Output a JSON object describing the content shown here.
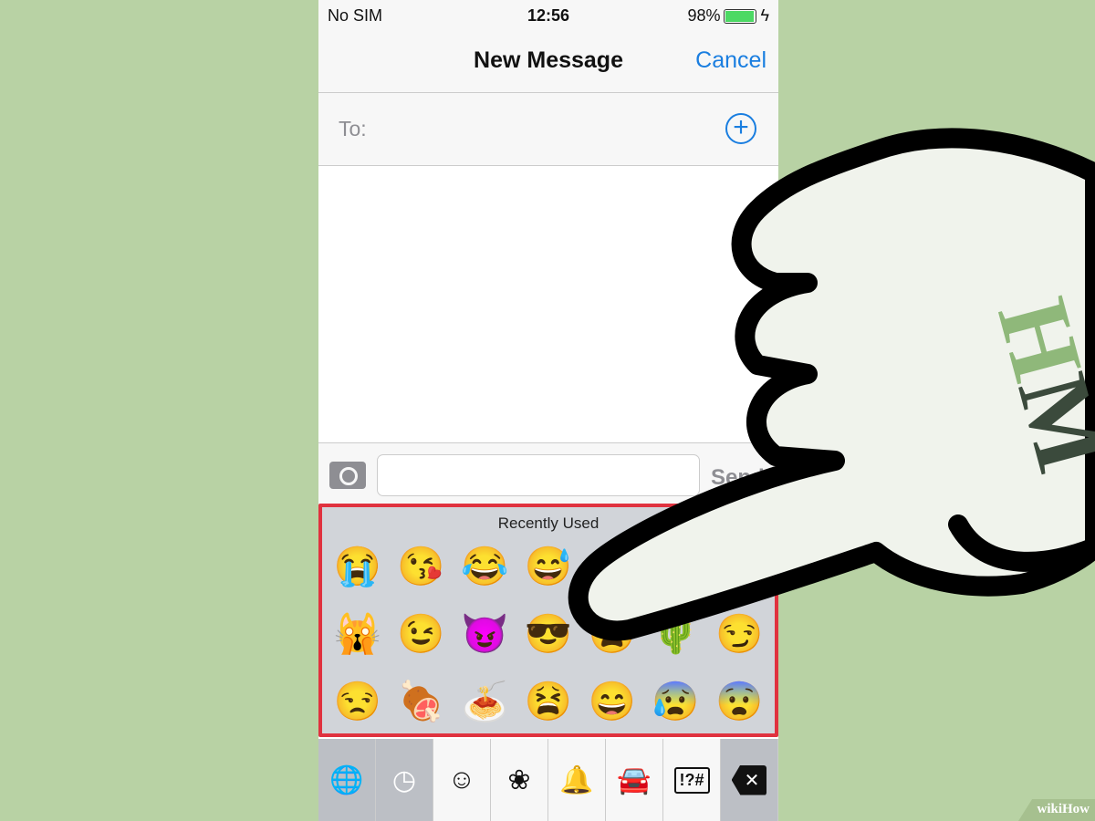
{
  "status": {
    "carrier": "No SIM",
    "time": "12:56",
    "battery": "98%",
    "battery_level": 0.98
  },
  "nav": {
    "title": "New Message",
    "cancel": "Cancel"
  },
  "to": {
    "label": "To:",
    "add": "+"
  },
  "input": {
    "value": "",
    "send": "Send"
  },
  "emoji_keyboard": {
    "section": "Recently Used",
    "emojis": [
      "😭",
      "😘",
      "😂",
      "😅",
      "☺",
      "😋",
      "😜",
      "🙀",
      "😉",
      "😈",
      "😎",
      "😩",
      "🌵",
      "😏",
      "😒",
      "🍖",
      "🍝",
      "😫",
      "😄",
      "😰",
      "😨"
    ]
  },
  "tabs": [
    {
      "icon": "globe-icon",
      "glyph": "🌐"
    },
    {
      "icon": "clock-icon",
      "glyph": "◷"
    },
    {
      "icon": "smiley-icon",
      "glyph": "☺"
    },
    {
      "icon": "flower-icon",
      "glyph": "❀"
    },
    {
      "icon": "bell-icon",
      "glyph": "🔔"
    },
    {
      "icon": "car-icon",
      "glyph": "🚘"
    },
    {
      "icon": "symbols-icon",
      "glyph": "!?#"
    },
    {
      "icon": "delete-icon",
      "glyph": "✕"
    }
  ],
  "hand_logo": "HM",
  "watermark": "wikiHow",
  "colors": {
    "background": "#b8d2a4",
    "accent": "#1a7ee0",
    "highlight": "#e0323f"
  }
}
